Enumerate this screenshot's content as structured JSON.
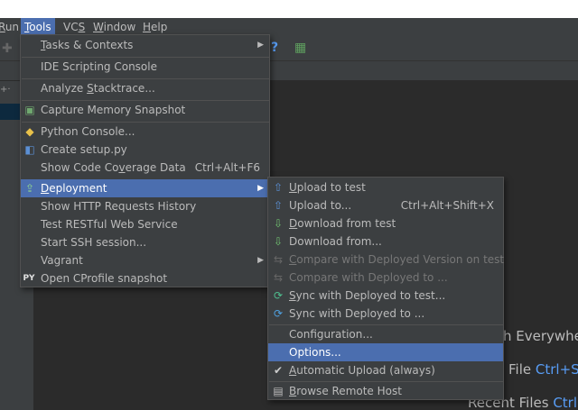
{
  "menubar": {
    "items": [
      {
        "pre": "",
        "u": "R",
        "post": "un"
      },
      {
        "pre": "",
        "u": "T",
        "post": "ools"
      },
      {
        "pre": "VC",
        "u": "S",
        "post": ""
      },
      {
        "pre": "",
        "u": "W",
        "post": "indow"
      },
      {
        "pre": "",
        "u": "H",
        "post": "elp"
      }
    ]
  },
  "tools_menu": {
    "items": [
      {
        "pre": "",
        "u": "T",
        "post": "asks & Contexts"
      },
      {
        "label": "IDE Scripting Console"
      },
      {
        "pre": "Analyze ",
        "u": "S",
        "post": "tacktrace..."
      },
      {
        "label": "Capture Memory Snapshot"
      },
      {
        "label": "Python Console..."
      },
      {
        "label": "Create setup.py"
      },
      {
        "pre": "Show Code Co",
        "u": "v",
        "post": "erage Data",
        "shortcut": "Ctrl+Alt+F6"
      },
      {
        "pre": "",
        "u": "D",
        "post": "eployment"
      },
      {
        "label": "Show HTTP Requests History"
      },
      {
        "label": "Test RESTful Web Service"
      },
      {
        "label": "Start SSH session..."
      },
      {
        "label": "Vagrant"
      },
      {
        "label": "Open CProfile snapshot"
      }
    ]
  },
  "deployment_menu": {
    "items": [
      {
        "pre": "",
        "u": "U",
        "post": "pload to test"
      },
      {
        "label": "Upload to...",
        "shortcut": "Ctrl+Alt+Shift+X"
      },
      {
        "pre": "",
        "u": "D",
        "post": "ownload from test"
      },
      {
        "label": "Download from..."
      },
      {
        "pre": "",
        "u": "C",
        "post": "ompare with Deployed Version on test"
      },
      {
        "label": "Compare with Deployed to ..."
      },
      {
        "pre": "",
        "u": "S",
        "post": "ync with Deployed to test..."
      },
      {
        "label": "Sync with Deployed to ..."
      },
      {
        "label": "Configuration..."
      },
      {
        "label": "Options..."
      },
      {
        "pre": "",
        "u": "A",
        "post": "utomatic Upload (always)"
      },
      {
        "pre": "",
        "u": "B",
        "post": "rowse Remote Host"
      }
    ]
  },
  "background": {
    "hint1": "h Everywhe",
    "hint2_label": "File",
    "hint2_key": "Ctrl+S",
    "hint3_label": "Recent Files",
    "hint3_key": "Ctrl"
  },
  "colors": {
    "selection": "#4b6eaf",
    "menu_bg": "#3c3f41",
    "editor_bg": "#2b2b2b",
    "shortcut_blue": "#589df6"
  }
}
